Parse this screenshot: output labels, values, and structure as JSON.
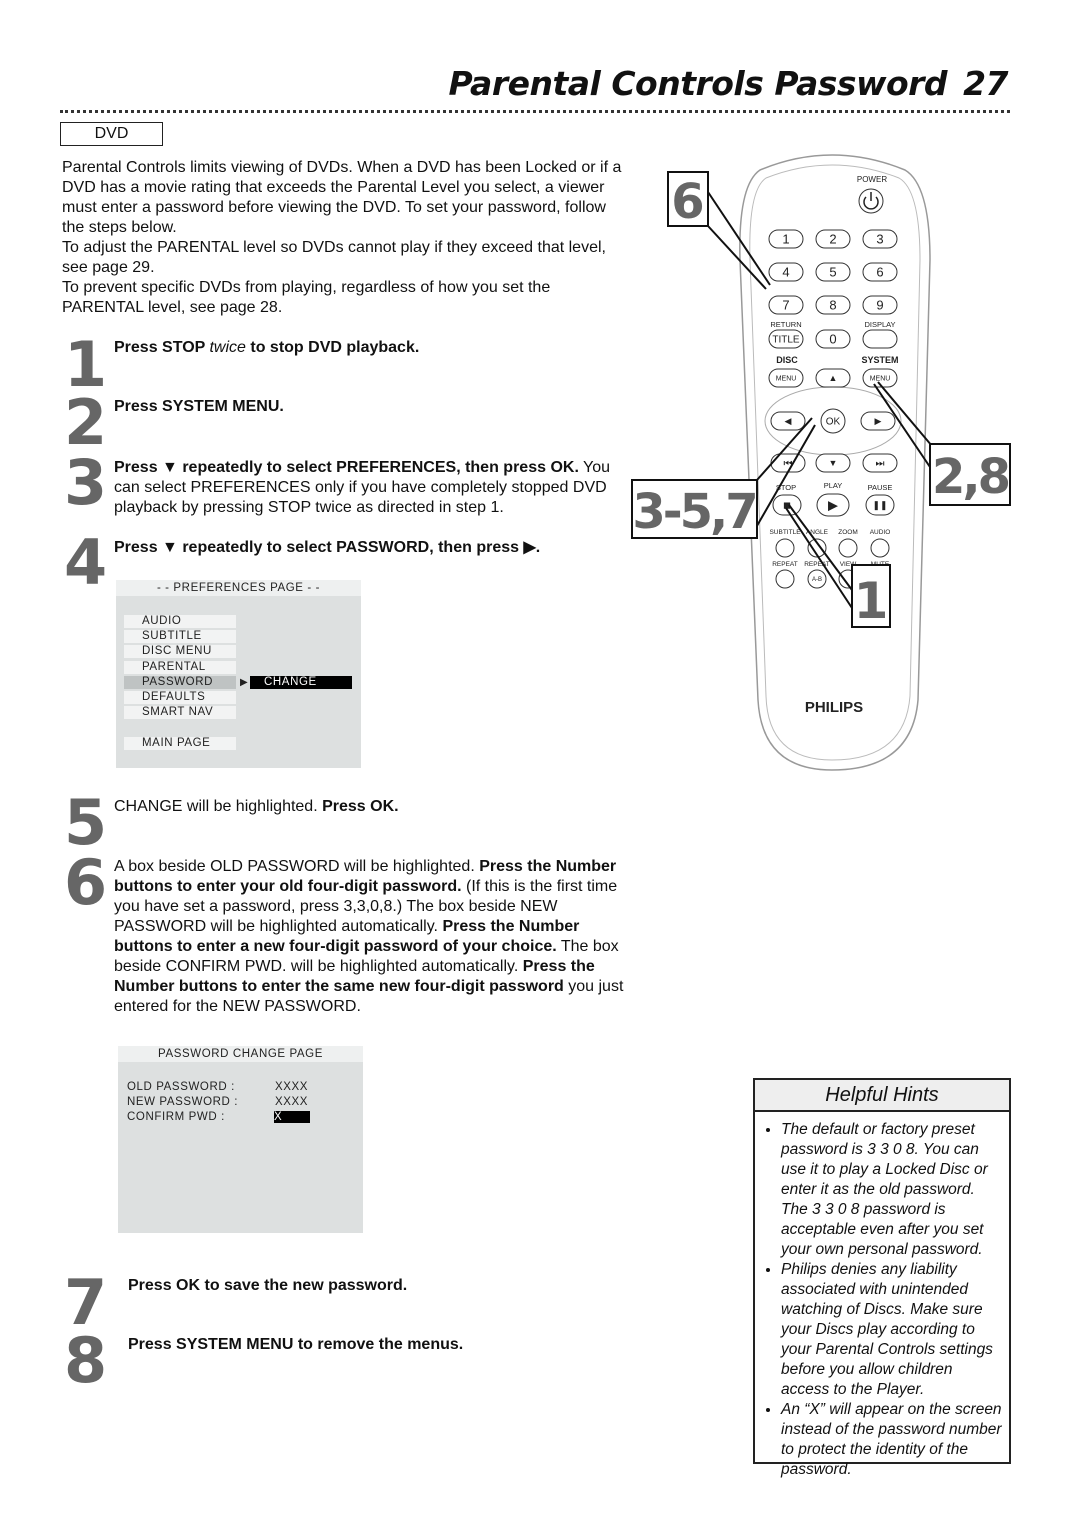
{
  "header": {
    "title": "Parental Controls Password",
    "page_number": "27",
    "section_tag": "DVD"
  },
  "intro": [
    "Parental Controls limits viewing of DVDs. When a DVD has been Locked or if a DVD has a movie rating that exceeds the Parental Level you select, a viewer must enter a password before viewing the DVD. To set your pass­word, follow the steps below.",
    "To adjust the PARENTAL level so DVDs cannot play if they exceed that level, see page 29.",
    "To prevent specific DVDs from playing, regardless of how you set the PARENTAL level, see page 28."
  ],
  "steps": [
    {
      "num": "1",
      "segments": [
        {
          "t": "Press STOP ",
          "s": "b"
        },
        {
          "t": "   twice",
          "s": "i"
        },
        {
          "t": " to stop DVD playback.",
          "s": "b"
        }
      ]
    },
    {
      "num": "2",
      "segments": [
        {
          "t": "Press SYSTEM MENU.",
          "s": "b"
        }
      ]
    },
    {
      "num": "3",
      "segments": [
        {
          "t": "Press ▼ repeatedly to select PREFERENCES, then press OK.",
          "s": "b"
        },
        {
          "t": " You can select PREFERENCES only if you have completely stopped DVD playback by pressing STOP    twice as directed in step 1.",
          "s": ""
        }
      ]
    },
    {
      "num": "4",
      "segments": [
        {
          "t": "Press ▼ repeatedly to select PASSWORD, then press ▶.",
          "s": "b"
        }
      ]
    },
    {
      "num": "5",
      "segments": [
        {
          "t": "CHANGE will be highlighted. ",
          "s": ""
        },
        {
          "t": "Press OK.",
          "s": "b"
        }
      ]
    },
    {
      "num": "6",
      "segments": [
        {
          "t": "A box beside OLD PASSWORD will be highlighted. ",
          "s": ""
        },
        {
          "t": "Press the Number buttons to enter your old four-digit password.",
          "s": "b"
        },
        {
          "t": " (If this is the first time you have set a password, press 3,3,0,8.) The box beside NEW PASSWORD will be highlighted automatically. ",
          "s": ""
        },
        {
          "t": "Press the Number buttons to enter a new four-digit password of your choice.",
          "s": "b"
        },
        {
          "t": " The box beside CONFIRM PWD. will be highlighted automatically. ",
          "s": ""
        },
        {
          "t": "Press the Number buttons to enter the same new four-digit password",
          "s": "b"
        },
        {
          "t": " you just entered for the NEW PASSWORD.",
          "s": ""
        }
      ]
    },
    {
      "num": "7",
      "segments": [
        {
          "t": "Press OK to save the new password.",
          "s": "b"
        }
      ]
    },
    {
      "num": "8",
      "segments": [
        {
          "t": "Press SYSTEM MENU to remove the menus.",
          "s": "b"
        }
      ]
    }
  ],
  "preferences_menu": {
    "title": "- -  PREFERENCES PAGE  - -",
    "items": [
      "AUDIO",
      "SUBTITLE",
      "DISC MENU",
      "PARENTAL",
      "PASSWORD",
      "DEFAULTS",
      "SMART NAV"
    ],
    "selected": "PASSWORD",
    "change_label": "CHANGE",
    "arrow": "▶",
    "main_page": "MAIN PAGE"
  },
  "password_menu": {
    "title": "PASSWORD CHANGE PAGE",
    "rows": [
      {
        "label": "OLD PASSWORD :",
        "value": "XXXX"
      },
      {
        "label": "NEW PASSWORD :",
        "value": "XXXX"
      },
      {
        "label": "CONFIRM PWD :",
        "value": "X"
      }
    ]
  },
  "hints": {
    "title": "Helpful Hints",
    "items": [
      "The default or factory preset password is 3 3 0 8. You can use it to play a Locked Disc or enter it as the old password. The 3 3 0 8 password is acceptable even after you set your own per­sonal password.",
      "Philips denies any liability associ­ated with unintended watching of Discs. Make sure your Discs play according to your Parental Controls settings before you allow children access to the Player.",
      "An “X” will appear on the screen instead of the password number to protect the identity of the password."
    ]
  },
  "remote": {
    "brand": "PHILIPS",
    "power": "POWER",
    "digits": [
      "1",
      "2",
      "3",
      "4",
      "5",
      "6",
      "7",
      "8",
      "9"
    ],
    "return": "RETURN",
    "display": "DISPLAY",
    "title": "TITLE",
    "zero": "0",
    "disc": "DISC",
    "system": "SYSTEM",
    "menu": "MENU",
    "ok": "OK",
    "stop": "STOP",
    "play": "PLAY",
    "pause": "PAUSE",
    "subtitle": "SUBTITLE",
    "angle": "ANGLE",
    "zoom": "ZOOM",
    "audio": "AUDIO",
    "repeat": "REPEAT",
    "repeat_ab": "REPEAT",
    "ab": "A-B",
    "view": "VIEW",
    "mute": "MUTE",
    "callouts": [
      "6",
      "3-5,7",
      "2,8",
      "1"
    ]
  }
}
